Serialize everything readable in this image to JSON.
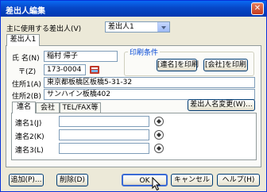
{
  "window": {
    "title": "差出人編集",
    "close_glyph": "✕"
  },
  "main_sender": {
    "label": "主に使用する差出人(V)",
    "value": "差出人1"
  },
  "tabs": [
    {
      "label": "差出人1"
    }
  ],
  "form": {
    "name_label": "氏 名(N)",
    "name_value": "稲村 帰子",
    "zip_label": "〒(Z)",
    "zip_value": "173-0004",
    "addr1_label": "住所1(A)",
    "addr1_value": "東京都板橋区板橋5-31-32",
    "addr2_label": "住所2(B)",
    "addr2_value": "サンハイン板橋402"
  },
  "print_conditions": {
    "title": "印刷条件",
    "renmei_button": "[連名]を印刷",
    "company_button": "[会社]を印刷"
  },
  "subtabs": [
    {
      "label": "連名"
    },
    {
      "label": "会社"
    },
    {
      "label": "TEL/FAX等"
    }
  ],
  "change_sender_button": "差出人名変更(W)...",
  "renmei": [
    {
      "label": "連名1(J)",
      "value": ""
    },
    {
      "label": "連名2(K)",
      "value": ""
    },
    {
      "label": "連名3(L)",
      "value": ""
    }
  ],
  "buttons": {
    "add": "追加(P)...",
    "delete": "削除(D)",
    "ok": "OK",
    "cancel": "キャンセル",
    "help": "ヘルプ(H)"
  }
}
